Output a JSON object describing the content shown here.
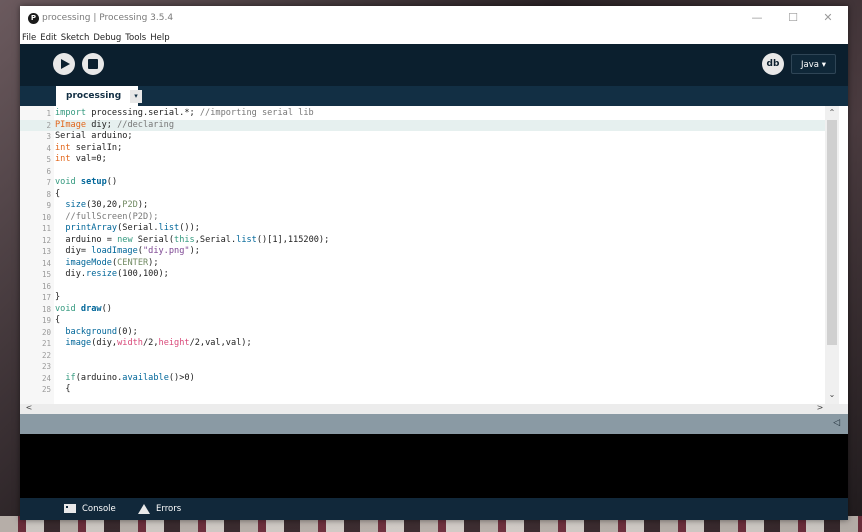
{
  "window": {
    "title": "processing | Processing 3.5.4",
    "controls": {
      "minimize": "—",
      "maximize": "☐",
      "close": "✕"
    }
  },
  "menu": [
    "File",
    "Edit",
    "Sketch",
    "Debug",
    "Tools",
    "Help"
  ],
  "toolbar": {
    "run_icon": "play-icon",
    "stop_icon": "stop-icon",
    "debug_label": "db",
    "mode_label": "Java ▾"
  },
  "tabs": [
    {
      "label": "processing",
      "menu_glyph": "▾"
    }
  ],
  "editor": {
    "highlighted_line": 2,
    "lines": [
      [
        {
          "t": "import",
          "c": "#33997e"
        },
        {
          "t": " processing.serial.*; ",
          "c": "#222222"
        },
        {
          "t": "//importing serial lib",
          "c": "#777777"
        }
      ],
      [
        {
          "t": "PImage",
          "c": "#e2661a"
        },
        {
          "t": " diy; ",
          "c": "#222222"
        },
        {
          "t": "//declaring",
          "c": "#777777"
        }
      ],
      [
        {
          "t": "Serial arduino;",
          "c": "#222222"
        }
      ],
      [
        {
          "t": "int",
          "c": "#e2661a"
        },
        {
          "t": " serialIn;",
          "c": "#222222"
        }
      ],
      [
        {
          "t": "int",
          "c": "#e2661a"
        },
        {
          "t": " val=0;",
          "c": "#222222"
        }
      ],
      [],
      [
        {
          "t": "void",
          "c": "#33997e"
        },
        {
          "t": " ",
          "c": "#222222"
        },
        {
          "t": "setup",
          "c": "#006699",
          "b": true
        },
        {
          "t": "()",
          "c": "#222222"
        }
      ],
      [
        {
          "t": "{",
          "c": "#222222"
        }
      ],
      [
        {
          "t": "  ",
          "c": "#222222"
        },
        {
          "t": "size",
          "c": "#006699"
        },
        {
          "t": "(30,20,",
          "c": "#222222"
        },
        {
          "t": "P2D",
          "c": "#718a62"
        },
        {
          "t": ");",
          "c": "#222222"
        }
      ],
      [
        {
          "t": "  //fullScreen(P2D);",
          "c": "#777777"
        }
      ],
      [
        {
          "t": "  ",
          "c": "#222222"
        },
        {
          "t": "printArray",
          "c": "#006699"
        },
        {
          "t": "(Serial.",
          "c": "#222222"
        },
        {
          "t": "list",
          "c": "#006699"
        },
        {
          "t": "());",
          "c": "#222222"
        }
      ],
      [
        {
          "t": "  arduino = ",
          "c": "#222222"
        },
        {
          "t": "new",
          "c": "#33997e"
        },
        {
          "t": " Serial(",
          "c": "#222222"
        },
        {
          "t": "this",
          "c": "#33997e"
        },
        {
          "t": ",Serial.",
          "c": "#222222"
        },
        {
          "t": "list",
          "c": "#006699"
        },
        {
          "t": "()[1],115200);",
          "c": "#222222"
        }
      ],
      [
        {
          "t": "  diy= ",
          "c": "#222222"
        },
        {
          "t": "loadImage",
          "c": "#006699"
        },
        {
          "t": "(",
          "c": "#222222"
        },
        {
          "t": "\"diy.png\"",
          "c": "#7d4793"
        },
        {
          "t": ");",
          "c": "#222222"
        }
      ],
      [
        {
          "t": "  ",
          "c": "#222222"
        },
        {
          "t": "imageMode",
          "c": "#006699"
        },
        {
          "t": "(",
          "c": "#222222"
        },
        {
          "t": "CENTER",
          "c": "#718a62"
        },
        {
          "t": ");",
          "c": "#222222"
        }
      ],
      [
        {
          "t": "  diy.",
          "c": "#222222"
        },
        {
          "t": "resize",
          "c": "#006699"
        },
        {
          "t": "(100,100);",
          "c": "#222222"
        }
      ],
      [],
      [
        {
          "t": "}",
          "c": "#222222"
        }
      ],
      [
        {
          "t": "void",
          "c": "#33997e"
        },
        {
          "t": " ",
          "c": "#222222"
        },
        {
          "t": "draw",
          "c": "#006699",
          "b": true
        },
        {
          "t": "()",
          "c": "#222222"
        }
      ],
      [
        {
          "t": "{",
          "c": "#222222"
        }
      ],
      [
        {
          "t": "  ",
          "c": "#222222"
        },
        {
          "t": "background",
          "c": "#006699"
        },
        {
          "t": "(0);",
          "c": "#222222"
        }
      ],
      [
        {
          "t": "  ",
          "c": "#222222"
        },
        {
          "t": "image",
          "c": "#006699"
        },
        {
          "t": "(diy,",
          "c": "#222222"
        },
        {
          "t": "width",
          "c": "#d94a7a"
        },
        {
          "t": "/2,",
          "c": "#222222"
        },
        {
          "t": "height",
          "c": "#d94a7a"
        },
        {
          "t": "/2,val,val);",
          "c": "#222222"
        }
      ],
      [],
      [],
      [
        {
          "t": "  ",
          "c": "#222222"
        },
        {
          "t": "if",
          "c": "#33997e"
        },
        {
          "t": "(arduino.",
          "c": "#222222"
        },
        {
          "t": "available",
          "c": "#006699"
        },
        {
          "t": "()>0)",
          "c": "#222222"
        }
      ],
      [
        {
          "t": "  {",
          "c": "#222222"
        }
      ]
    ]
  },
  "scroll": {
    "up": "⌃",
    "down": "⌄",
    "left": "<",
    "right": ">"
  },
  "status": {
    "toggle_glyph": "◁"
  },
  "footer": {
    "console_label": "Console",
    "errors_label": "Errors"
  }
}
